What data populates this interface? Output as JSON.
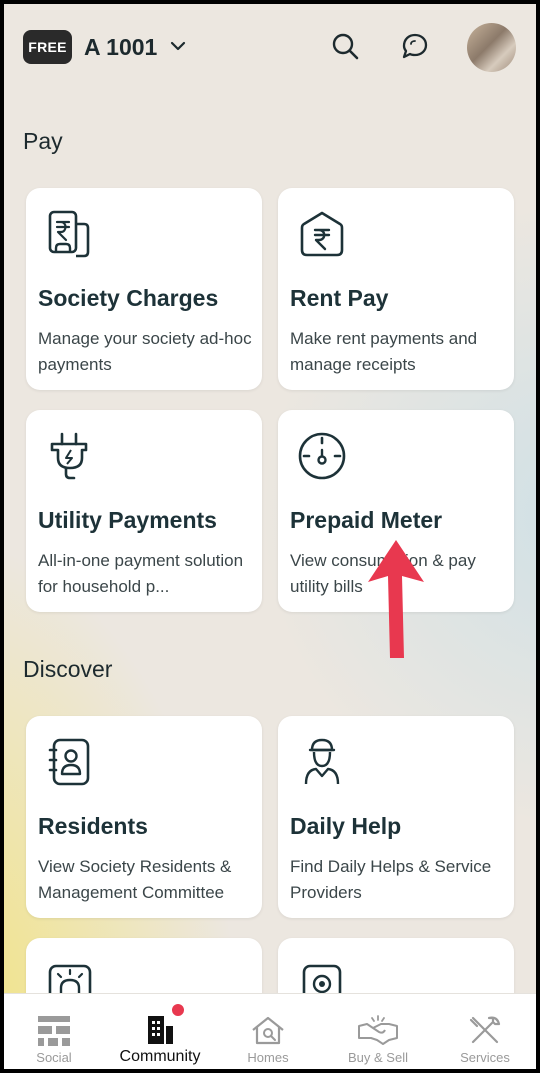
{
  "header": {
    "badge": "FREE",
    "flat": "A 1001",
    "icons": [
      "chevron-down-icon",
      "search-icon",
      "chat-icon",
      "avatar"
    ]
  },
  "sections": {
    "pay": "Pay",
    "discover": "Discover"
  },
  "cards": {
    "society_charges": {
      "title": "Society Charges",
      "desc": "Manage your society ad-hoc payments",
      "icon": "invoice-icon"
    },
    "rent_pay": {
      "title": "Rent Pay",
      "desc": "Make rent payments and manage receipts",
      "icon": "house-rupee-icon"
    },
    "utility_payments": {
      "title": "Utility Payments",
      "desc": "All-in-one payment solution for household p...",
      "icon": "plug-icon"
    },
    "prepaid_meter": {
      "title": "Prepaid Meter",
      "desc": "View consumption & pay utility bills",
      "icon": "meter-icon"
    },
    "residents": {
      "title": "Residents",
      "desc": "View Society Residents & Management Committee",
      "icon": "contact-book-icon"
    },
    "daily_help": {
      "title": "Daily Help",
      "desc": "Find Daily Helps & Service Providers",
      "icon": "helper-icon"
    }
  },
  "nav": {
    "social": "Social",
    "community": "Community",
    "homes": "Homes",
    "buy_sell": "Buy & Sell",
    "services": "Services"
  },
  "colors": {
    "accent_red": "#e8384f",
    "text_dark": "#1d3238",
    "background": "#ece7e0"
  }
}
